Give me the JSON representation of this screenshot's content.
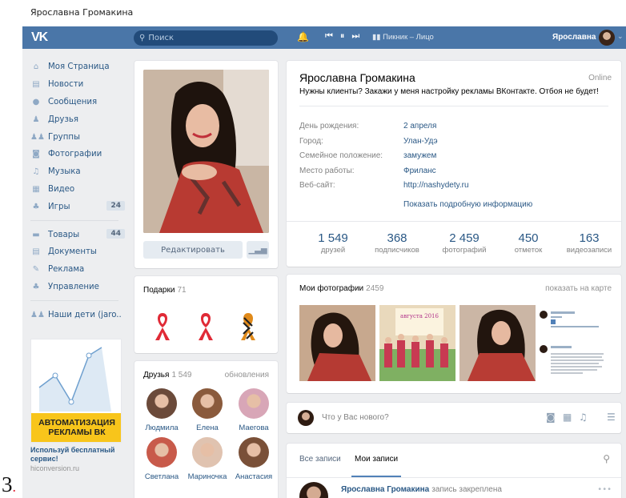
{
  "document": {
    "header": "Ярославна Громакина",
    "page_number": "3"
  },
  "topbar": {
    "search_placeholder": "Поиск",
    "track": "Пикник – Лицо",
    "user_name": "Ярославна"
  },
  "left_nav": {
    "items": [
      {
        "label": "Моя Страница",
        "icon": "home-icon"
      },
      {
        "label": "Новости",
        "icon": "news-icon"
      },
      {
        "label": "Сообщения",
        "icon": "messages-icon"
      },
      {
        "label": "Друзья",
        "icon": "friends-icon"
      },
      {
        "label": "Группы",
        "icon": "groups-icon"
      },
      {
        "label": "Фотографии",
        "icon": "camera-icon"
      },
      {
        "label": "Музыка",
        "icon": "music-icon"
      },
      {
        "label": "Видео",
        "icon": "video-icon"
      },
      {
        "label": "Игры",
        "icon": "games-icon",
        "badge": "24"
      }
    ],
    "items2": [
      {
        "label": "Товары",
        "icon": "bag-icon",
        "badge": "44"
      },
      {
        "label": "Документы",
        "icon": "document-icon"
      },
      {
        "label": "Реклама",
        "icon": "ads-icon"
      },
      {
        "label": "Управление",
        "icon": "manage-icon"
      }
    ],
    "group": {
      "label": "Наши дети (jaro..",
      "icon": "group-icon"
    }
  },
  "ad": {
    "banner_line1": "АВТОМАТИЗАЦИЯ",
    "banner_line2": "РЕКЛАМЫ ВК",
    "title": "Используй бесплатный сервис!",
    "url": "hiconversion.ru",
    "banner_color": "#f8c51b"
  },
  "profile": {
    "edit_label": "Редактировать",
    "name": "Ярославна Громакина",
    "online": "Online",
    "status": "Нужны клиенты? Закажи у меня настройку рекламы ВКонтакте. Отбоя не будет!",
    "fields": [
      {
        "label": "День рождения:",
        "value": "2 апреля"
      },
      {
        "label": "Город:",
        "value": "Улан-Удэ"
      },
      {
        "label": "Семейное положение:",
        "value": "замужем"
      },
      {
        "label": "Место работы:",
        "value": "Фриланс"
      },
      {
        "label": "Веб-сайт:",
        "value": "http://nashydety.ru"
      }
    ],
    "more_info": "Показать подробную информацию",
    "counters": [
      {
        "num": "1 549",
        "label": "друзей"
      },
      {
        "num": "368",
        "label": "подписчиков"
      },
      {
        "num": "2 459",
        "label": "фотографий"
      },
      {
        "num": "450",
        "label": "отметок"
      },
      {
        "num": "163",
        "label": "видеозаписи"
      }
    ]
  },
  "gifts": {
    "title": "Подарки",
    "count": "71"
  },
  "friends": {
    "title": "Друзья",
    "count": "1 549",
    "updates": "обновления",
    "list": [
      {
        "name": "Людмила"
      },
      {
        "name": "Елена"
      },
      {
        "name": "Маегова"
      },
      {
        "name": "Светлана"
      },
      {
        "name": "Мариночка"
      },
      {
        "name": "Анастасия"
      }
    ]
  },
  "photos": {
    "title": "Мои фотографии",
    "count": "2459",
    "map_link": "показать на карте"
  },
  "post_box": {
    "placeholder": "Что у Вас нового?"
  },
  "wall": {
    "tab_all": "Все записи",
    "tab_mine": "Мои записи",
    "post_author": "Ярославна Громакина",
    "post_pinned": "запись закреплена"
  },
  "colors": {
    "header": "#4a76a8",
    "link": "#2a5885",
    "background": "#edeef0",
    "accent": "#5181b8"
  }
}
